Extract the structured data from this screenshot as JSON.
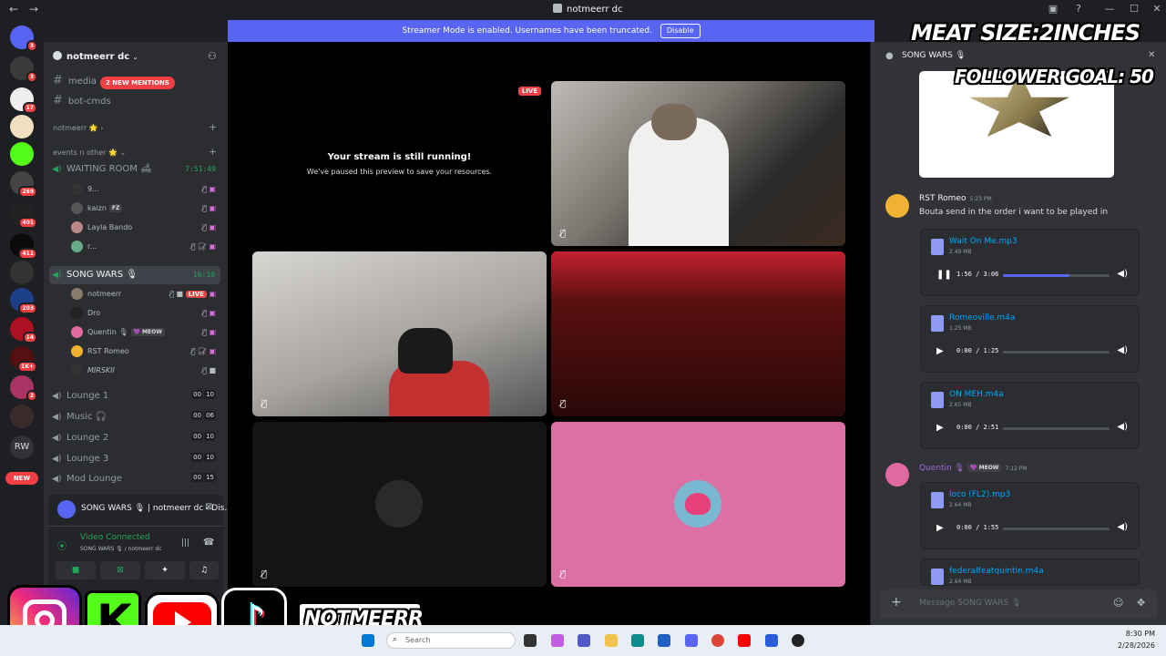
{
  "window": {
    "title": "notmeerr dc",
    "back": "←",
    "forward": "→"
  },
  "banner": {
    "text": "Streamer Mode is enabled. Usernames have been truncated.",
    "button": "Disable"
  },
  "rail": {
    "servers": [
      {
        "badge": "3",
        "color": "#5865f2"
      },
      {
        "badge": "3",
        "color": "#3a3a3a"
      },
      {
        "badge": "17",
        "color": "#eeeeee"
      },
      {
        "badge": "",
        "color": "#f0e0c0"
      },
      {
        "badge": "",
        "color": "#53fc18"
      },
      {
        "badge": "269",
        "color": "#444"
      },
      {
        "badge": "401",
        "color": "#222"
      },
      {
        "badge": "411",
        "color": "#0a0a0a"
      },
      {
        "badge": "",
        "color": "#333"
      },
      {
        "badge": "203",
        "color": "#1d3f8a"
      },
      {
        "badge": "14",
        "color": "#aa1122"
      },
      {
        "badge": "1K+",
        "color": "#551111"
      },
      {
        "badge": "2",
        "color": "#aa3366"
      },
      {
        "badge": "",
        "color": "#3a2a2a"
      }
    ],
    "rw_label": "RW",
    "new_label": "NEW"
  },
  "sidebar": {
    "server_name": "notmeerr dc",
    "mentions": "2 NEW MENTIONS",
    "text_channels": [
      "media",
      "bot-cmds"
    ],
    "category1": "notmeerr 🌟",
    "category2": "events n other 🌟",
    "waiting_room": {
      "name": "WAITING ROOM 🛋",
      "timer": "7:51:49"
    },
    "waiting_users": [
      {
        "name": "9...",
        "tag": ""
      },
      {
        "name": "kaizn",
        "tag": "FZ"
      },
      {
        "name": "Layla Bando",
        "tag": ""
      },
      {
        "name": "r...",
        "tag": ""
      }
    ],
    "song_wars": {
      "name": "SONG WARS 🎙",
      "timer": "16:19"
    },
    "song_users": [
      {
        "name": "notmeerr",
        "tag": "",
        "live": "LIVE"
      },
      {
        "name": "Dro",
        "tag": ""
      },
      {
        "name": "Quentin 🎙",
        "tag": "💜 MEOW"
      },
      {
        "name": "RST Romeo",
        "tag": ""
      },
      {
        "name": "MIRSKII",
        "tag": ""
      }
    ],
    "lounges": [
      {
        "name": "Lounge 1",
        "a": "00",
        "b": "10"
      },
      {
        "name": "Music 🎧",
        "a": "00",
        "b": "06"
      },
      {
        "name": "Lounge 2",
        "a": "00",
        "b": "10"
      },
      {
        "name": "Lounge 3",
        "a": "00",
        "b": "10"
      },
      {
        "name": "Mod Lounge",
        "a": "00",
        "b": "15"
      }
    ],
    "voice_panel": {
      "activity": "SONG WARS 🎙 | notmeerr dc - Dis...",
      "status": "Video Connected",
      "location": "SONG WARS 🎙 / notmeerr dc"
    }
  },
  "stage": {
    "live_label": "LIVE",
    "stream_title": "Your stream is still running!",
    "stream_sub": "We've paused this preview to save your resources."
  },
  "chat": {
    "header": "SONG WARS 🎙",
    "messages": [
      {
        "author": "RST Romeo",
        "time": "5:23 PM",
        "text": "Bouta send in the order i want to be played in"
      },
      {
        "author": "Quentin 🎙",
        "tag": "💜 MEOW",
        "time": "7:12 PM"
      }
    ],
    "attachments": [
      {
        "name": "Wait On Me.mp3",
        "size": "2.49 MB",
        "time": "1:56 / 3:06",
        "progress": 0.62,
        "playing": true
      },
      {
        "name": "Romeoville.m4a",
        "size": "1.25 MB",
        "time": "0:00 / 1:25",
        "progress": 0.0,
        "playing": false
      },
      {
        "name": "ON MEH.m4a",
        "size": "2.65 MB",
        "time": "0:00 / 2:51",
        "progress": 0.0,
        "playing": false
      },
      {
        "name": "loco (FL2).mp3",
        "size": "2.64 MB",
        "time": "0:00 / 1:55",
        "progress": 0.0,
        "playing": false
      },
      {
        "name": "federalfeatquintin.m4a",
        "size": "2.64 MB"
      }
    ],
    "input_placeholder": "Message SONG WARS 🎙"
  },
  "overlay": {
    "line1": "MEAT SIZE:2INCHES",
    "line2": "FOLLOWER GOAL: 50",
    "handle": "NOTMEERR"
  },
  "taskbar": {
    "search": "Search",
    "time": "8:30 PM",
    "date": "2/28/2026"
  },
  "colors": {
    "accent": "#5865f2",
    "live": "#ed4245",
    "green": "#23a55a",
    "link": "#00a8fc"
  }
}
